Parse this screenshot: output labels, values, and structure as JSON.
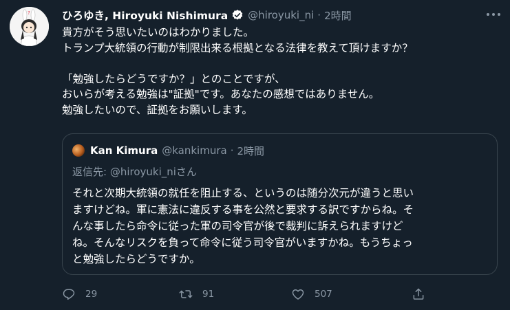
{
  "tweet": {
    "author_name": "ひろゆき, Hiroyuki Nishimura",
    "handle": "@hiroyuki_ni",
    "separator": "·",
    "time": "2時間",
    "lines": [
      "貴方がそう思いたいのはわかりました。",
      "トランプ大統領の行動が制限出来る根拠となる法律を教えて頂けますか？",
      "",
      "「勉強したらどうですか？」とのことですが、",
      "おいらが考える勉強は\"証拠\"です。あなたの感想ではありません。",
      "勉強したいので、証拠をお願いします。"
    ]
  },
  "quoted": {
    "author_name": "Kan Kimura",
    "handle": "@kankimura",
    "separator": "·",
    "time": "2時間",
    "reply_prefix": "返信先: ",
    "reply_mention": "@hiroyuki_ni",
    "reply_suffix": "さん",
    "lines": [
      "それと次期大統領の就任を阻止する、というのは随分次元が違うと思い",
      "ますけどね。軍に憲法に違反する事を公然と要求する訳ですからね。そ",
      "んな事したら命令に従った軍の司令官が後で裁判に訴えられますけど",
      "ね。そんなリスクを負って命令に従う司令官がいますかね。もうちょっ",
      "と勉強したらどうですか。"
    ]
  },
  "actions": {
    "reply_count": "29",
    "retweet_count": "91",
    "like_count": "507"
  },
  "icons": {
    "verified": "verified-badge-icon",
    "more": "more-icon",
    "reply": "reply-icon",
    "retweet": "retweet-icon",
    "like": "heart-icon",
    "share": "share-icon"
  },
  "colors": {
    "background": "#15202b",
    "text": "#ffffff",
    "secondary": "#8b98a5",
    "border": "#38444d",
    "verified": "#ffffff"
  }
}
